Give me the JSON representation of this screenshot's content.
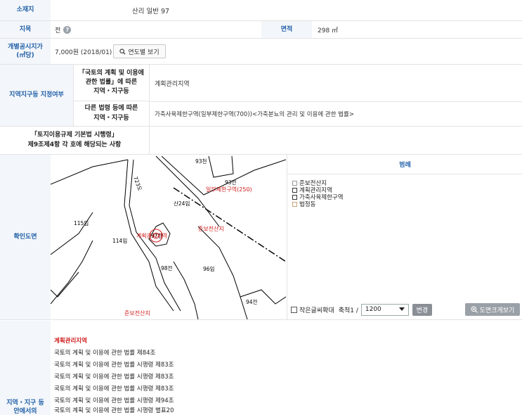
{
  "location": {
    "label": "소재지",
    "value": "산리 일반 97"
  },
  "jimok": {
    "label": "지목",
    "value": "전",
    "help_icon": "?"
  },
  "area": {
    "label": "면적",
    "value": "298 ㎡"
  },
  "price": {
    "label_line1": "개별공시지가",
    "label_line2": "(㎡당)",
    "value": "7,000원 (2018/01)",
    "button_label": "연도별 보기",
    "button_icon": "search-icon"
  },
  "zoning": {
    "label": "지역지구등 지정여부",
    "sub1": {
      "line1": "「국토의 계획 및 이용에",
      "line2": "관한 법률」에 따른",
      "line3": "지역・지구등",
      "value": "계획관리지역"
    },
    "sub2": {
      "line1": "다른 법령 등에 따른",
      "line2": "지역・지구등",
      "value": "가축사육제한구역(일부제한구역(700))<가축분뇨의 관리 및 이용에 관한 법률>"
    }
  },
  "enforcement": {
    "line1": "「토지이용규제 기본법 시행령」",
    "line2": "제9조제4항 각 호에 해당되는 사항",
    "value": ""
  },
  "map_section": {
    "label": "확인도면",
    "map_labels": {
      "parcel_93": "93천",
      "parcel_93_2": "93전",
      "road_723": "723도",
      "restriction_zone": "일부제한구역(250)",
      "mountain_24": "산24임",
      "parcel_115": "115임",
      "parcel_114": "114임",
      "plan_zone": "계획관리지역",
      "parcel_97": "97전",
      "prep_forest_1": "준보전산지",
      "parcel_98": "98전",
      "parcel_96": "96임",
      "parcel_94": "94전",
      "prep_forest_2": "준보전산지"
    },
    "legend_title": "범례",
    "legend_items": [
      "준보전산지",
      "계획관리지역",
      "가축사육제한구역",
      "법정동"
    ],
    "small_text_label": "작은글씨확대",
    "scale_label": "축척1 /",
    "scale_value": "1200",
    "change_button": "변경",
    "enlarge_button": "도면크게보기"
  },
  "acts_section": {
    "label_line1": "지역・지구 등",
    "label_line2": "안에서의",
    "heading": "계획관리지역",
    "items": [
      "국토의 계획 및 이용에 관한 법률 제84조",
      "국토의 계획 및 이용에 관한 법률 시행령 제83조",
      "국토의 계획 및 이용에 관한 법률 시행령 제83조",
      "국토의 계획 및 이용에 관한 법률 시행령 제83조",
      "국토의 계획 및 이용에 관한 법률 시행령 제94조",
      "국토의 계획 및 이용에 관한 법률 시행령 별표20"
    ]
  },
  "colors": {
    "label_blue": "#1f5fa8",
    "label_bg": "#f3f6fa",
    "zone_red": "#d11a1a"
  }
}
